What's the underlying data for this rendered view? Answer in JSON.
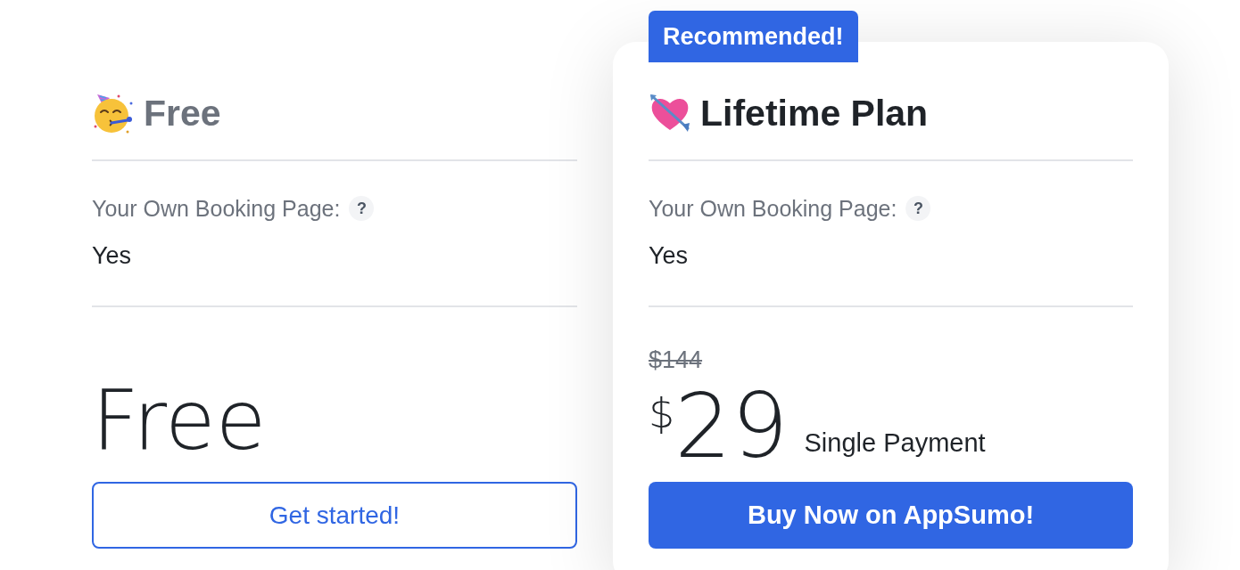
{
  "plans": [
    {
      "title": "Free",
      "highlighted": false,
      "features": [
        {
          "label": "Your Own Booking Page:",
          "help": "?",
          "value": "Yes"
        }
      ],
      "price": {
        "kind": "text",
        "text": "Free"
      },
      "button": {
        "kind": "outline",
        "label": "Get started!"
      }
    },
    {
      "badge": "Recommended!",
      "title": "Lifetime Plan",
      "highlighted": true,
      "features": [
        {
          "label": "Your Own Booking Page:",
          "help": "?",
          "value": "Yes"
        }
      ],
      "price": {
        "kind": "amount",
        "original": "$144",
        "currency": "$",
        "amount": "29",
        "note": "Single Payment"
      },
      "button": {
        "kind": "solid",
        "label": "Buy Now on AppSumo!"
      }
    }
  ]
}
